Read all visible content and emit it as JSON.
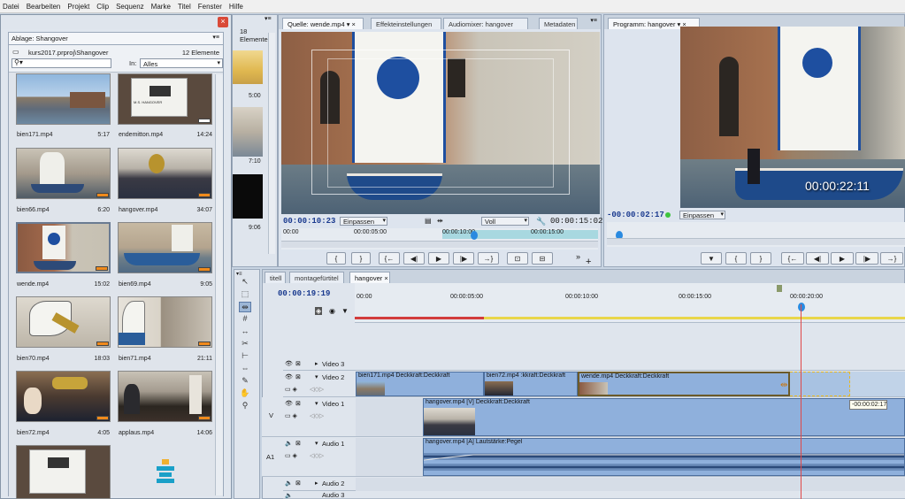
{
  "menu": [
    "Datei",
    "Bearbeiten",
    "Projekt",
    "Clip",
    "Sequenz",
    "Marke",
    "Titel",
    "Fenster",
    "Hilfe"
  ],
  "project": {
    "tab": "Ablage: Shangover",
    "path": "kurs2017.prproj\\Shangover",
    "count": "12 Elemente",
    "search_placeholder": "",
    "in_label": "In:",
    "in_value": "Alles",
    "items": [
      {
        "name": "bien171.mp4",
        "dur": "5:17"
      },
      {
        "name": "endemitton.mp4",
        "dur": "14:24"
      },
      {
        "name": "bien66.mp4",
        "dur": "6:20"
      },
      {
        "name": "hangover.mp4",
        "dur": "34:07"
      },
      {
        "name": "wende.mp4",
        "dur": "15:02"
      },
      {
        "name": "bien69.mp4",
        "dur": "9:05"
      },
      {
        "name": "bien70.mp4",
        "dur": "18:03"
      },
      {
        "name": "bien71.mp4",
        "dur": "21:11"
      },
      {
        "name": "bien72.mp4",
        "dur": "4:05"
      },
      {
        "name": "applaus.mp4",
        "dur": "14:06"
      }
    ],
    "slate_text": "M.S. HANGOVER"
  },
  "mini_bin": {
    "count": "18 Elemente",
    "durations": [
      "5:00",
      "7:10",
      "9:06"
    ]
  },
  "source": {
    "tabs": [
      "Quelle: wende.mp4",
      "Effekteinstellungen",
      "Audiomixer: hangover",
      "Metadaten"
    ],
    "timecode_in": "00:00:10:23",
    "fit": "Einpassen",
    "quality": "Voll",
    "timecode_dur": "00:00:15:02",
    "ruler": [
      "00:00",
      "00:00:05:00",
      "00:00:10:00",
      "00:00:15:00"
    ]
  },
  "program": {
    "tab": "Programm: hangover",
    "overlay_tc": "00:00:22:11",
    "timecode": "-00:00:02:17",
    "fit": "Einpassen"
  },
  "timeline": {
    "tabs": [
      "titell",
      "montagefürtitel",
      "hangover"
    ],
    "timecode": "00:00:19:19",
    "ruler": [
      "00:00",
      "00:00:05:00",
      "00:00:10:00",
      "00:00:15:00",
      "00:00:20:00"
    ],
    "tracks": {
      "video3": "Video 3",
      "video2": "Video 2",
      "video1": "Video 1",
      "audio1": "Audio 1",
      "audio2": "Audio 2",
      "audio3": "Audio 3",
      "v_label": "V",
      "a1_label": "A1"
    },
    "clips": {
      "v2a": "bien171.mp4 Deckkraft:Deckkraft",
      "v2b": "bien72.mp4 :kkraft:Deckkraft",
      "v2c": "wende.mp4 Deckkraft:Deckkraft",
      "v1": "hangover.mp4 [V] Deckkraft:Deckkraft",
      "a1": "hangover.mp4 [A] Lautstärke:Pegel"
    },
    "tooltip": "-00:00:02:17"
  }
}
